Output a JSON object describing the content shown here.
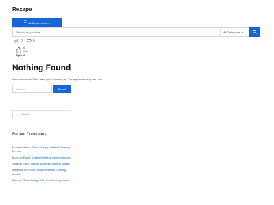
{
  "site": {
    "title": "Rexape"
  },
  "header": {
    "departments_label": "All Departments",
    "search_placeholder": "Search for products",
    "category_label": "All Categories",
    "compare_count": "0",
    "wishlist_count": "0",
    "cart_count": "0",
    "cart_label": "Cart",
    "cart_total": "Rp0.00"
  },
  "main": {
    "title": "Nothing Found",
    "description": "It seems we can't find what you're looking for. Perhaps searching can help.",
    "search_placeholder": "Search ...",
    "search_button": "Search"
  },
  "sidebar": {
    "search_placeholder": "Search...",
    "recent_comments_title": "Recent Comments",
    "comments": [
      {
        "author": "Mohammad",
        "on": "on",
        "link": "Robot Design Wireless Gaming Mouse"
      },
      {
        "author": "Mora",
        "on": "on",
        "link": "Robot Design Wireless Gaming Mouse"
      },
      {
        "author": "Yara",
        "on": "on",
        "link": "Robot Design Wireless Gaming Mouse"
      },
      {
        "author": "Bayende",
        "on": "on",
        "link": "Robot Design Wireless Gaming Mouse"
      },
      {
        "author": "Dora",
        "on": "on",
        "link": "Robot Design Wireless Gaming Mouse"
      }
    ]
  },
  "icons": {
    "menu": "menu-icon",
    "chevron": "chevron-down-icon",
    "search": "search-icon",
    "compare": "compare-icon",
    "heart": "heart-icon",
    "cart": "cart-icon"
  },
  "colors": {
    "accent": "#1565d8",
    "border": "#d9d9d9",
    "text": "#222222"
  }
}
